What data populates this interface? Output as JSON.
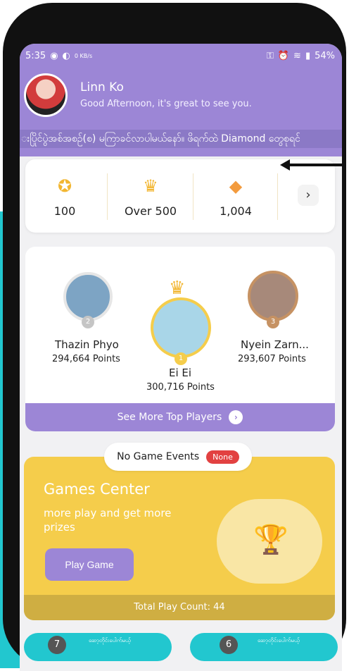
{
  "status_bar": {
    "time": "5:35",
    "left_icons": [
      "message-icon",
      "volume-icon"
    ],
    "network_speed": "0 KB/s",
    "battery": "54%"
  },
  "user": {
    "name": "Linn Ko",
    "greeting": "Good Afternoon, it's great to see you."
  },
  "marquee_text": "းပြိုင်ပွဲအစ်အစဉ်(စ) မကြာခင်လာပါမယ်နော်။ ဖိရက်ထဲ Diamond တွေစုရင်",
  "stats": [
    {
      "icon": "star-icon",
      "value": "100"
    },
    {
      "icon": "crown-icon",
      "value": "Over 500"
    },
    {
      "icon": "diamond-icon",
      "value": "1,004"
    }
  ],
  "leaders": [
    {
      "rank": "2",
      "name": "Thazin Phyo",
      "points": "294,664  Points"
    },
    {
      "rank": "1",
      "name": "Ei Ei",
      "points": "300,716  Points"
    },
    {
      "rank": "3",
      "name": "Nyein Zarn...",
      "points": "293,607  Points"
    }
  ],
  "see_more_label": "See More Top Players",
  "events": {
    "label": "No Game Events",
    "badge": "None"
  },
  "games": {
    "title": "Games Center",
    "subtitle": "more play and get more prizes",
    "play_button": "Play Game",
    "footer": "Total Play Count: 44"
  },
  "mini_cards": [
    {
      "number": "7",
      "text": "ဆော့တိုင်းပေါက်မယ့်"
    },
    {
      "number": "6",
      "text": "ဆော့တိုင်းပေါက်မယ့်"
    }
  ]
}
